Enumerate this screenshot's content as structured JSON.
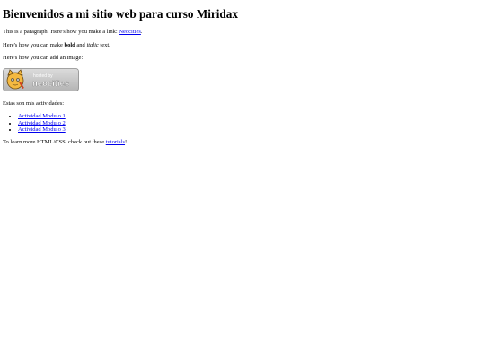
{
  "heading": "Bienvenidos a mi sitio web para curso Miridax",
  "para1": {
    "before": "This is a paragraph! Here's how you make a link: ",
    "link": "Neocities",
    "after": "."
  },
  "para2": {
    "before": "Here's how you can make ",
    "bold": "bold",
    "middle": " and ",
    "italic": "italic",
    "after": " text."
  },
  "para3": "Here's how you can add an image:",
  "badge": {
    "small_text": "hosted by",
    "big_text": "neocities",
    "icon": "neocities-cat-icon"
  },
  "activities_intro": "Estas son mis actividades:",
  "activities": [
    "Actividad Modulo 1",
    "Actividad Modulo 2",
    "Actividad Modulo 3"
  ],
  "para4": {
    "before": "To learn more HTML/CSS, check out these ",
    "link": "tutorials",
    "after": "!"
  },
  "colors": {
    "link": "#0000ee",
    "text": "#000000",
    "badge_bg": "#c8c8c8"
  }
}
